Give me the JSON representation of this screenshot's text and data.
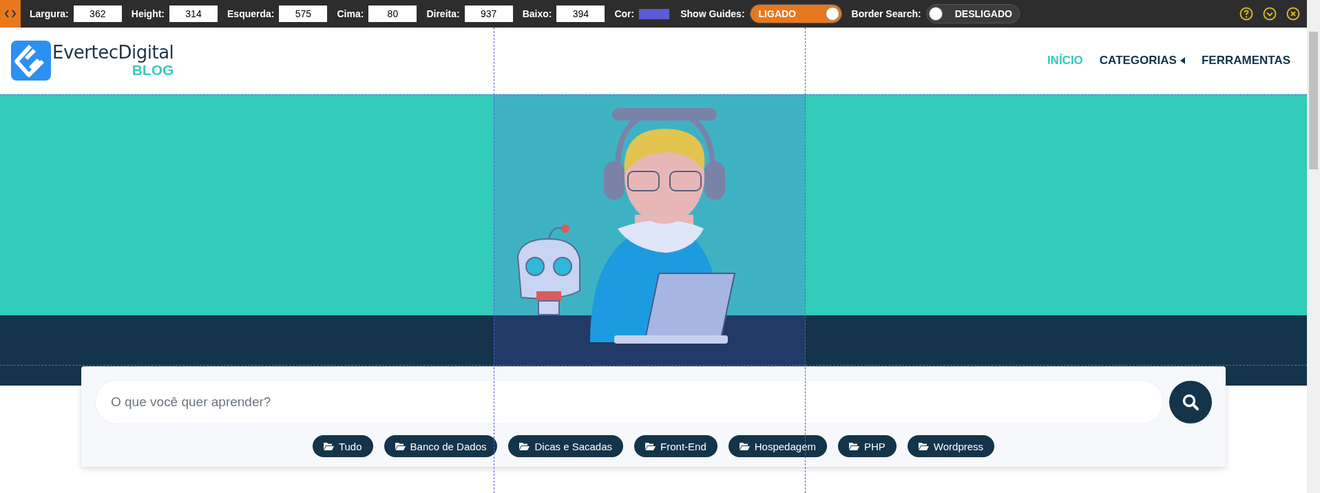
{
  "toolbar": {
    "fields": [
      {
        "label": "Largura:",
        "value": "362"
      },
      {
        "label": "Height:",
        "value": "314"
      },
      {
        "label": "Esquerda:",
        "value": "575"
      },
      {
        "label": "Cima:",
        "value": "80"
      },
      {
        "label": "Direita:",
        "value": "937"
      },
      {
        "label": "Baixo:",
        "value": "394"
      }
    ],
    "color": {
      "label": "Cor:",
      "color": "#5b5bd6"
    },
    "toggles": [
      {
        "label": "Show Guides:",
        "on": true,
        "text": "LIGADO"
      },
      {
        "label": "Border Search:",
        "on": false,
        "text": "DESLIGADO"
      }
    ]
  },
  "header": {
    "logo": {
      "name": "EvertecDigital",
      "sub": "BLOG"
    },
    "nav": [
      {
        "label": "INÍCIO",
        "selected": true,
        "has_submenu": false
      },
      {
        "label": "CATEGORIAS",
        "selected": false,
        "has_submenu": true
      },
      {
        "label": "FERRAMENTAS",
        "selected": false,
        "has_submenu": false
      }
    ]
  },
  "search": {
    "placeholder": "O que você quer aprender?"
  },
  "categories": [
    "Tudo",
    "Banco de Dados",
    "Dicas e Sacadas",
    "Front-End",
    "Hospedagem",
    "PHP",
    "Wordpress"
  ]
}
